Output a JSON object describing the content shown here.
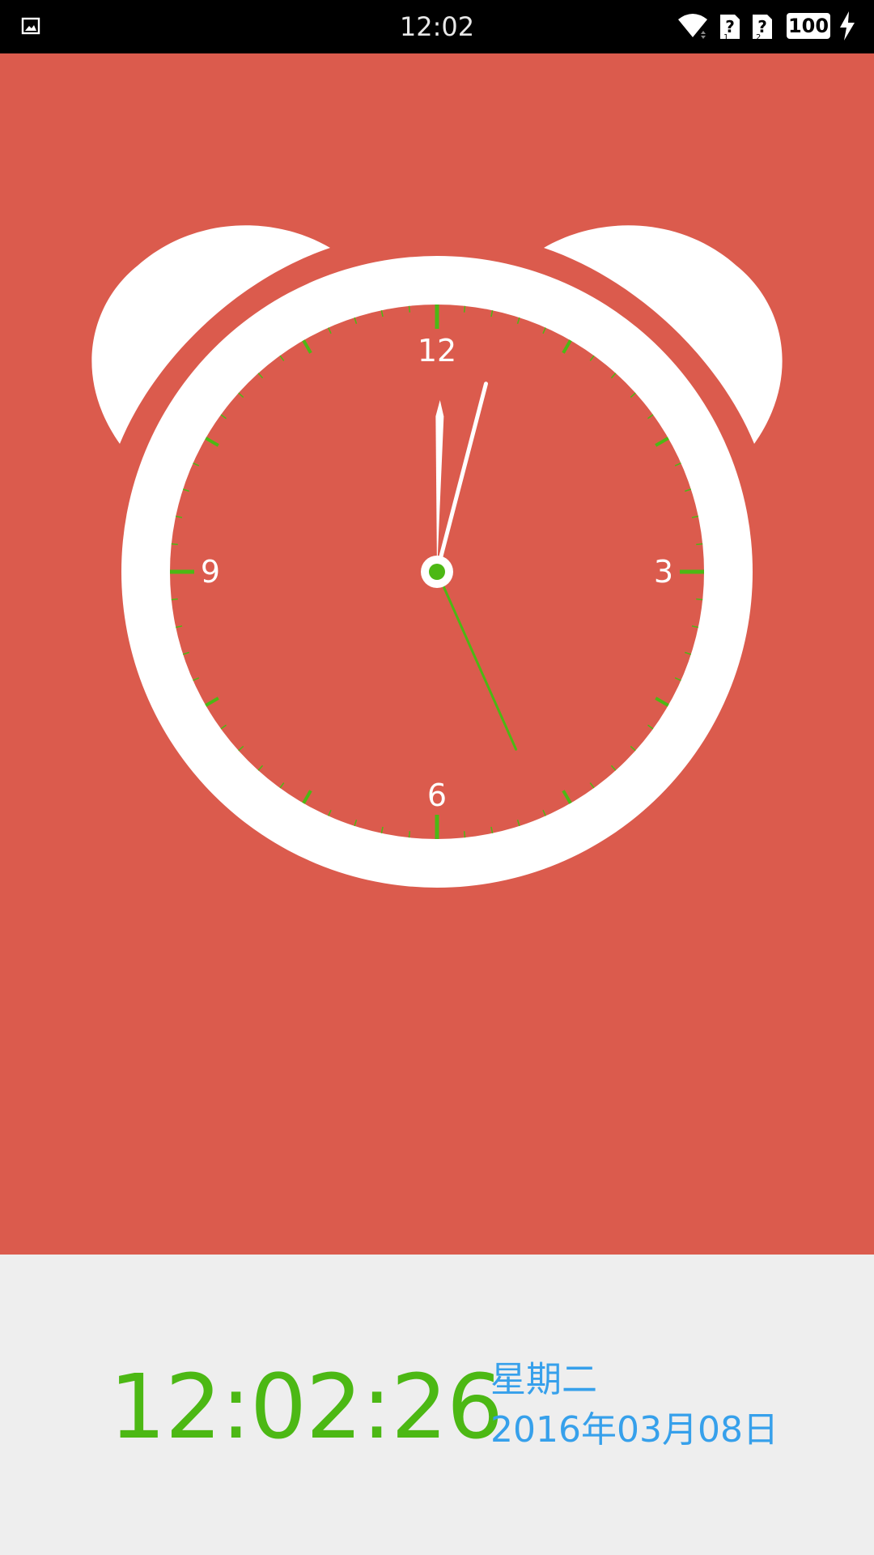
{
  "status_bar": {
    "time": "12:02",
    "battery_level": "100",
    "left_icon": "image-notification-icon",
    "right_icons": [
      "wifi-icon",
      "sim1-unknown-icon",
      "sim2-unknown-icon",
      "battery-icon",
      "charging-icon"
    ]
  },
  "clock": {
    "numerals": {
      "twelve": "12",
      "three": "3",
      "six": "6",
      "nine": "9"
    },
    "time": {
      "hours": 12,
      "minutes": 2,
      "seconds": 26
    }
  },
  "digital": {
    "time": "12:02:26",
    "weekday": "星期二",
    "date": "2016年03月08日"
  },
  "colors": {
    "panel_background": "#db5b4d",
    "bottom_background": "#eeeeee",
    "clock_white": "#ffffff",
    "accent_green": "#4cb814",
    "date_blue": "#36a0eb"
  }
}
